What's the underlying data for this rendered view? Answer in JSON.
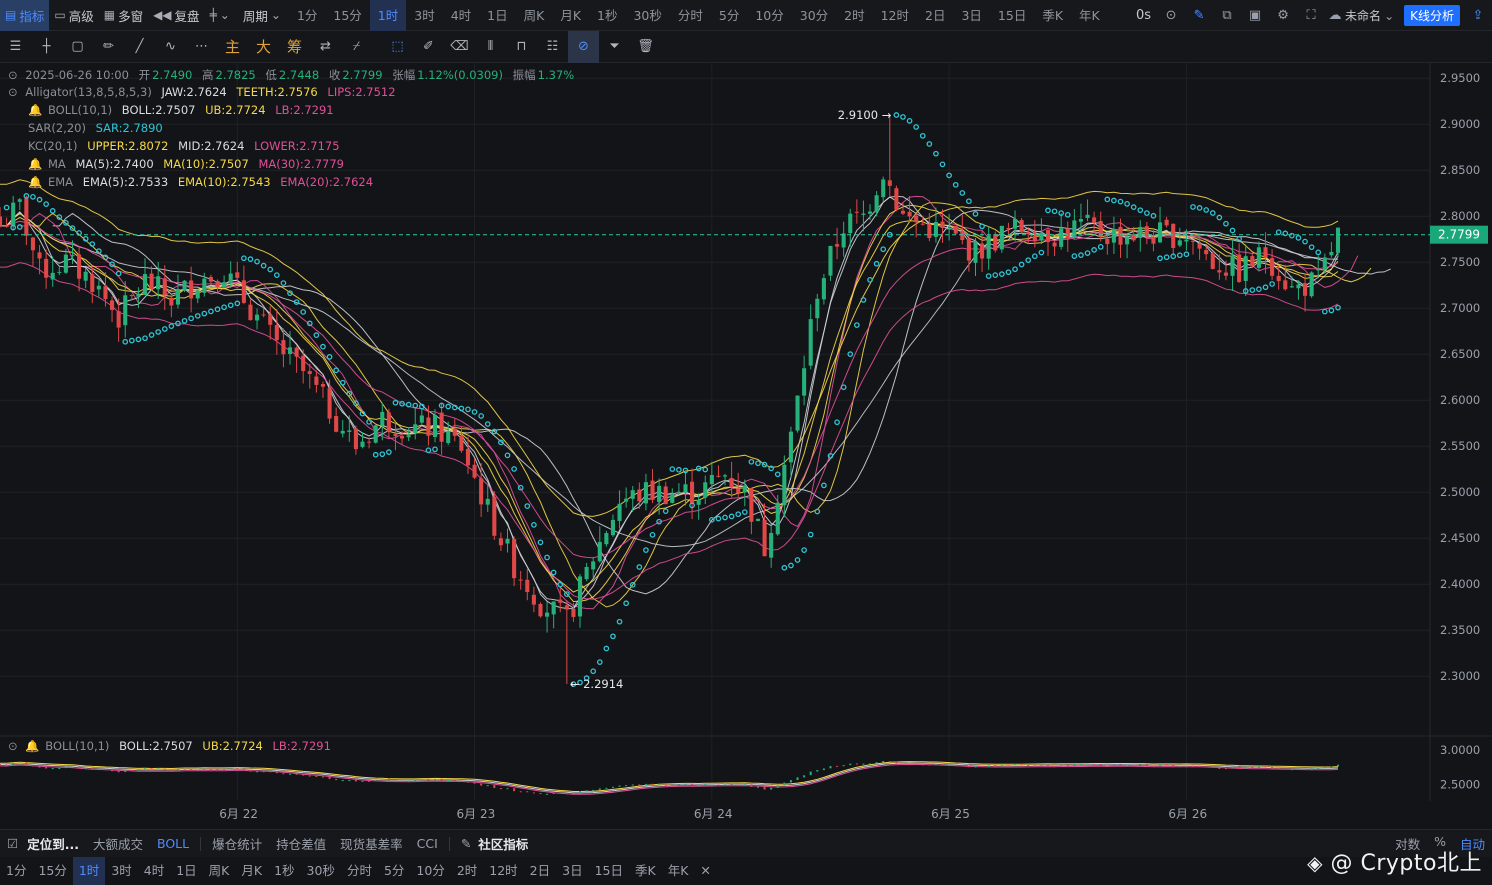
{
  "toolbar": {
    "indicator": "指标",
    "advanced": "高级",
    "multi": "多窗",
    "replay": "复盘",
    "period": "周期",
    "periods": [
      "1分",
      "15分",
      "1时",
      "3时",
      "4时",
      "1日",
      "周K",
      "月K",
      "1秒",
      "30秒",
      "分时",
      "5分",
      "10分",
      "30分",
      "2时",
      "12时",
      "2日",
      "3日",
      "15日",
      "季K",
      "年K"
    ],
    "active_period": "1时",
    "timer": "0s",
    "workspace": "未命名",
    "kline_analysis": "K线分析"
  },
  "drawbar": {
    "main": "主",
    "big": "大",
    "chip": "筹"
  },
  "legend": {
    "ohlc": {
      "date": "2025-06-26 10:00",
      "open_label": "开",
      "open": "2.7490",
      "high_label": "高",
      "high": "2.7825",
      "low_label": "低",
      "low": "2.7448",
      "close_label": "收",
      "close": "2.7799",
      "chg_label": "张幅",
      "chg": "1.12%(0.0309)",
      "amp_label": "振幅",
      "amp": "1.37%"
    },
    "alligator": {
      "name": "Alligator(13,8,5,8,5,3)",
      "jaw": "JAW:2.7624",
      "teeth": "TEETH:2.7576",
      "lips": "LIPS:2.7512"
    },
    "boll": {
      "name": "BOLL(10,1)",
      "mid": "BOLL:2.7507",
      "ub": "UB:2.7724",
      "lb": "LB:2.7291"
    },
    "sar": {
      "name": "SAR(2,20)",
      "val": "SAR:2.7890"
    },
    "kc": {
      "name": "KC(20,1)",
      "upper": "UPPER:2.8072",
      "mid": "MID:2.7624",
      "lower": "LOWER:2.7175"
    },
    "ma": {
      "name": "MA",
      "ma5": "MA(5):2.7400",
      "ma10": "MA(10):2.7507",
      "ma30": "MA(30):2.7779"
    },
    "ema": {
      "name": "EMA",
      "ema5": "EMA(5):2.7533",
      "ema10": "EMA(10):2.7543",
      "ema20": "EMA(20):2.7624"
    },
    "sub_boll": {
      "name": "BOLL(10,1)",
      "mid": "BOLL:2.7507",
      "ub": "UB:2.7724",
      "lb": "LB:2.7291"
    }
  },
  "bottom": {
    "locate": "定位到...",
    "volume": "大额成交",
    "boll": "BOLL",
    "liq": "爆仓统计",
    "oi": "持仓差值",
    "basis": "现货基差率",
    "cci": "CCI",
    "community": "社区指标",
    "log": "对数",
    "pct": "%",
    "auto": "自动",
    "periods": [
      "1分",
      "15分",
      "1时",
      "3时",
      "4时",
      "1日",
      "周K",
      "月K",
      "1秒",
      "30秒",
      "分时",
      "5分",
      "10分",
      "2时",
      "12时",
      "2日",
      "3日",
      "15日",
      "季K",
      "年K"
    ],
    "active_period": "1时",
    "close_x": "✕"
  },
  "watermark": "@ Crypto北上",
  "colors": {
    "up": "#26b07a",
    "down": "#e04848",
    "sar": "#2ec5d4",
    "yellow": "#f5d84a",
    "pink": "#e0509a",
    "white": "#d0d3d9"
  },
  "chart_data": {
    "type": "candlestick",
    "y_axis": {
      "range": [
        2.26,
        2.96
      ],
      "ticks": [
        "2.9500",
        "2.9000",
        "2.8500",
        "2.8000",
        "2.7500",
        "2.7000",
        "2.6500",
        "2.6000",
        "2.5500",
        "2.5000",
        "2.4500",
        "2.4000",
        "2.3500",
        "2.3000"
      ]
    },
    "x_axis": {
      "labels": [
        "6月 22",
        "6月 23",
        "6月 24",
        "6月 25",
        "6月 26"
      ],
      "label_candle_index": [
        36,
        72,
        108,
        144,
        180
      ]
    },
    "last_price": "2.7799",
    "annotations": {
      "high": "2.9100 →",
      "low": "← 2.2914",
      "high_index": 135,
      "low_index": 86,
      "high_value": 2.91,
      "low_value": 2.2914
    },
    "sub_axis": {
      "range": [
        2.38,
        3.1
      ],
      "ticks": [
        "3.0000",
        "2.5000"
      ]
    },
    "path_knots": [
      [
        0,
        2.79
      ],
      [
        3,
        2.81
      ],
      [
        6,
        2.74
      ],
      [
        10,
        2.75
      ],
      [
        14,
        2.73
      ],
      [
        18,
        2.69
      ],
      [
        22,
        2.73
      ],
      [
        26,
        2.71
      ],
      [
        30,
        2.73
      ],
      [
        34,
        2.74
      ],
      [
        38,
        2.7
      ],
      [
        42,
        2.66
      ],
      [
        46,
        2.63
      ],
      [
        50,
        2.59
      ],
      [
        54,
        2.55
      ],
      [
        58,
        2.58
      ],
      [
        62,
        2.57
      ],
      [
        66,
        2.57
      ],
      [
        70,
        2.55
      ],
      [
        74,
        2.48
      ],
      [
        78,
        2.42
      ],
      [
        82,
        2.38
      ],
      [
        86,
        2.36
      ],
      [
        90,
        2.43
      ],
      [
        94,
        2.49
      ],
      [
        98,
        2.5
      ],
      [
        102,
        2.5
      ],
      [
        106,
        2.5
      ],
      [
        110,
        2.52
      ],
      [
        113,
        2.5
      ],
      [
        116,
        2.44
      ],
      [
        120,
        2.56
      ],
      [
        124,
        2.72
      ],
      [
        128,
        2.79
      ],
      [
        131,
        2.8
      ],
      [
        134,
        2.85
      ],
      [
        137,
        2.8
      ],
      [
        140,
        2.79
      ],
      [
        144,
        2.78
      ],
      [
        148,
        2.76
      ],
      [
        152,
        2.78
      ],
      [
        156,
        2.79
      ],
      [
        160,
        2.78
      ],
      [
        164,
        2.79
      ],
      [
        168,
        2.78
      ],
      [
        172,
        2.78
      ],
      [
        176,
        2.78
      ],
      [
        180,
        2.78
      ],
      [
        184,
        2.75
      ],
      [
        188,
        2.74
      ],
      [
        192,
        2.76
      ],
      [
        196,
        2.72
      ],
      [
        200,
        2.73
      ],
      [
        203,
        2.78
      ]
    ],
    "candle_count": 204
  }
}
